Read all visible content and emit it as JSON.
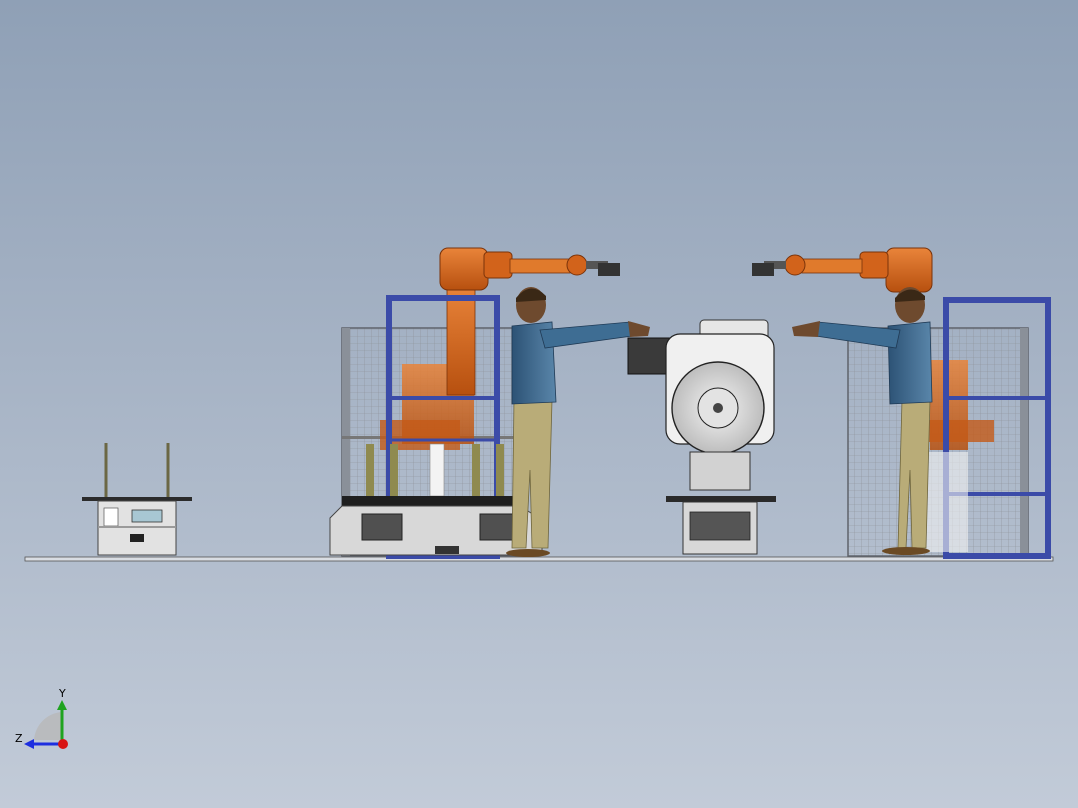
{
  "viewport": {
    "background_top": "#8fa0b6",
    "background_bottom": "#c2cbd8"
  },
  "triad": {
    "y_label": "Y",
    "z_label": "Z",
    "y_color": "#1fa31f",
    "z_color": "#1d2fe0",
    "x_color": "#d81414"
  },
  "colors": {
    "robot": "#d8681c",
    "robot_dark": "#8e3c0c",
    "frame": "#3b4ba8",
    "machine_base": "#e8e8e8",
    "shirt": "#3e6d93",
    "pants": "#b6aa76"
  }
}
